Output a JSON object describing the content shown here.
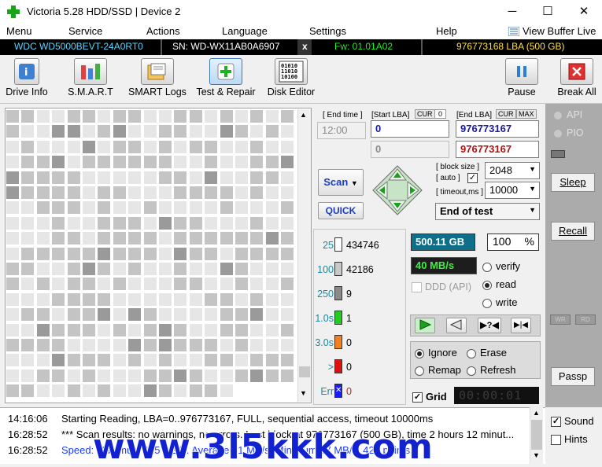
{
  "window": {
    "title": "Victoria 5.28 HDD/SSD | Device 2",
    "minimize": "─",
    "maximize": "☐",
    "close": "✕"
  },
  "menu": {
    "items": [
      "Menu",
      "Service",
      "Actions",
      "Language",
      "Settings",
      "Help"
    ],
    "view_buffer": "View Buffer Live"
  },
  "device": {
    "model": "WDC WD5000BEVT-24A0RT0",
    "serial": "SN: WD-WX11AB0A6907",
    "close_x": "x",
    "firmware": "Fw: 01.01A02",
    "capacity": "976773168 LBA (500 GB)"
  },
  "toolbar": {
    "drive_info": "Drive Info",
    "smart": "S.M.A.R.T",
    "smart_logs": "SMART Logs",
    "test_repair": "Test & Repair",
    "disk_editor": "Disk Editor",
    "pause": "Pause",
    "break_all": "Break All"
  },
  "test": {
    "end_time_label": "[ End time ]",
    "end_time_value": "12:00",
    "start_lba_label": "[Start LBA]",
    "cur_label": "CUR",
    "start_cur_value": "0",
    "end_lba_label": "[End LBA]",
    "max_label": "MAX",
    "start_lba": "0",
    "end_lba": "976773167",
    "start_lba_2": "0",
    "end_lba_2": "976773167",
    "scan_button": "Scan",
    "quick_button": "QUICK",
    "block_size_label": "[ block size ]",
    "auto_label": "[ auto ]",
    "block_size_value": "2048",
    "timeout_label": "[ timeout,ms ]",
    "timeout_value": "10000",
    "end_action": "End of test"
  },
  "legend": [
    {
      "label": "25",
      "count": "434746",
      "color": "#ffffff"
    },
    {
      "label": "100",
      "count": "42186",
      "color": "#c8c8c8"
    },
    {
      "label": "250",
      "count": "9",
      "color": "#8a8a8a"
    },
    {
      "label": "1.0s",
      "count": "1",
      "color": "#22cc22"
    },
    {
      "label": "3.0s",
      "count": "0",
      "color": "#f08020"
    },
    {
      "label": ">",
      "count": "0",
      "color": "#e01010"
    },
    {
      "label": "Err",
      "count": "0",
      "color": "#1a1aff"
    }
  ],
  "stats": {
    "size_done": "500.11 GB",
    "percent": "100",
    "percent_unit": "%",
    "speed": "40 MB/s",
    "ddd_label": "DDD (API)",
    "modes": [
      "verify",
      "read",
      "write"
    ],
    "selected_mode": "read",
    "repair_options": [
      "Ignore",
      "Erase",
      "Remap",
      "Refresh"
    ],
    "selected_repair": "Ignore",
    "grid_label": "Grid",
    "timer": "00:00:01"
  },
  "right_panel": {
    "api": "API",
    "pio": "PIO",
    "sleep": "Sleep",
    "recall": "Recall",
    "wr": "WR",
    "rd": "RD",
    "passp": "Passp",
    "sound": "Sound",
    "hints": "Hints"
  },
  "log": [
    {
      "time": "14:16:06",
      "text": "Starting Reading, LBA=0..976773167, FULL, sequential access, timeout 10000ms",
      "color": "#000000"
    },
    {
      "time": "16:28:52",
      "text": "*** Scan results: no warnings, no errors. Last block at 976773167 (500 GB), time 2 hours 12 minut...",
      "color": "#000000"
    },
    {
      "time": "16:28:52",
      "text": "Speed: Maximum 115 MB/s. Average 61 MB/s. Minimum 37 MB/s. 423 points.",
      "color": "#1a3cff"
    }
  ],
  "watermark": "www.3l5kkk.com",
  "map": {
    "progress": 1.0,
    "colors": {
      "light": "#e6e6e6",
      "mid": "#c4c4c4",
      "dark": "#9a9a9a"
    }
  }
}
